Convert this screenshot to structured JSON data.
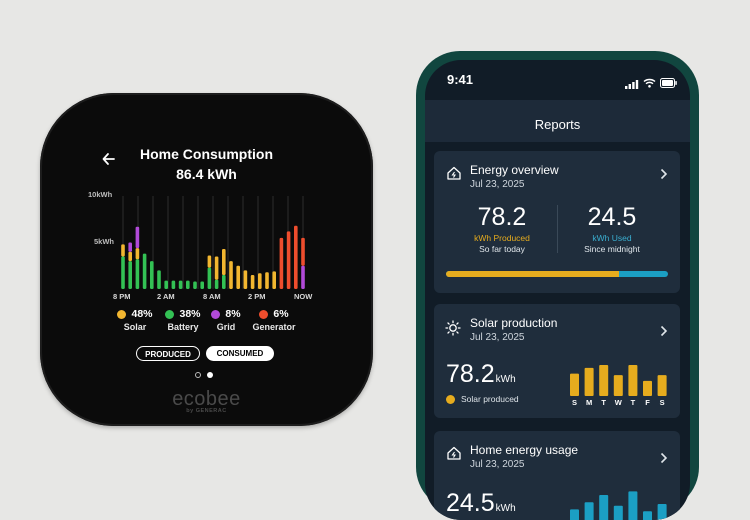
{
  "thermostat": {
    "back_icon": "arrow-left-icon",
    "title": "Home Consumption",
    "value": "86.4 kWh",
    "y_labels": [
      "10kWh",
      "5kWh"
    ],
    "x_labels": [
      "8 PM",
      "2 AM",
      "8 AM",
      "2 PM",
      "NOW"
    ],
    "legend": [
      {
        "pct": "48%",
        "name": "Solar",
        "color": "#f2b630"
      },
      {
        "pct": "38%",
        "name": "Battery",
        "color": "#33c154"
      },
      {
        "pct": "8%",
        "name": "Grid",
        "color": "#b14ad8"
      },
      {
        "pct": "6%",
        "name": "Generator",
        "color": "#ee4d2d"
      }
    ],
    "toggle_produced": "PRODUCED",
    "toggle_consumed": "CONSUMED",
    "page_index": 2,
    "page_count": 2,
    "brand": "ecobee",
    "brand_sub": "by GENERAC"
  },
  "chart_data": {
    "type": "bar",
    "ylim": [
      0,
      10
    ],
    "y_ticks": [
      "10kWh",
      "5kWh"
    ],
    "x_tick_labels": [
      "8 PM",
      "2 AM",
      "8 AM",
      "2 PM",
      "NOW"
    ],
    "series": [
      {
        "name": "Solar",
        "color": "#f2b630",
        "values": [
          1.3,
          1.0,
          1.2,
          0,
          0,
          0,
          0,
          0,
          0,
          0,
          0,
          0,
          1.3,
          2.5,
          2.8,
          3.0,
          2.5,
          2.0,
          1.5,
          1.7,
          1.8,
          1.9,
          0,
          0,
          0,
          0
        ]
      },
      {
        "name": "Battery",
        "color": "#33c154",
        "values": [
          3.5,
          3.0,
          3.2,
          3.8,
          3.0,
          2.0,
          0.9,
          0.9,
          0.9,
          0.9,
          0.8,
          0.8,
          2.3,
          1.0,
          1.5,
          0,
          0,
          0,
          0,
          0,
          0,
          0,
          0,
          0,
          0,
          0
        ]
      },
      {
        "name": "Grid",
        "color": "#b14ad8",
        "values": [
          0,
          1.0,
          2.3,
          0,
          0,
          0,
          0,
          0,
          0,
          0,
          0,
          0,
          0,
          0,
          0,
          0,
          0,
          0,
          0,
          0,
          0,
          0,
          0,
          0,
          0,
          2.5
        ]
      },
      {
        "name": "Generator",
        "color": "#ee4d2d",
        "values": [
          0,
          0,
          0,
          0,
          0,
          0,
          0,
          0,
          0,
          0,
          0,
          0,
          0,
          0,
          0,
          0,
          0,
          0,
          0,
          0,
          0,
          0,
          5.5,
          6.2,
          6.8,
          3.0
        ]
      }
    ]
  },
  "phone": {
    "time": "9:41",
    "header_title": "Reports",
    "energy_overview": {
      "icon": "home-energy-icon",
      "title": "Energy overview",
      "date": "Jul 23, 2025",
      "produced_value": "78.2",
      "produced_unit": "kWh Produced",
      "produced_sub": "So far today",
      "used_value": "24.5",
      "used_unit": "kWh Used",
      "used_sub": "Since midnight",
      "produced_fraction": 0.78,
      "color_produced": "#e6ac1e",
      "color_used": "#1b9fc4"
    },
    "solar": {
      "icon": "sun-icon",
      "title": "Solar production",
      "date": "Jul 23, 2025",
      "value": "78.2",
      "unit": "kWh",
      "legend": "Solar produced",
      "days": [
        "S",
        "M",
        "T",
        "W",
        "T",
        "F",
        "S"
      ],
      "levels": [
        0.62,
        0.78,
        0.86,
        0.58,
        0.86,
        0.42,
        0.58
      ],
      "color": "#e6ac1e"
    },
    "home_usage": {
      "icon": "home-energy-icon",
      "title": "Home energy usage",
      "date": "Jul 23, 2025",
      "value": "24.5",
      "unit": "kWh",
      "levels": [
        0.35,
        0.55,
        0.75,
        0.45,
        0.85,
        0.3,
        0.5
      ],
      "color": "#1b9fc4"
    }
  }
}
